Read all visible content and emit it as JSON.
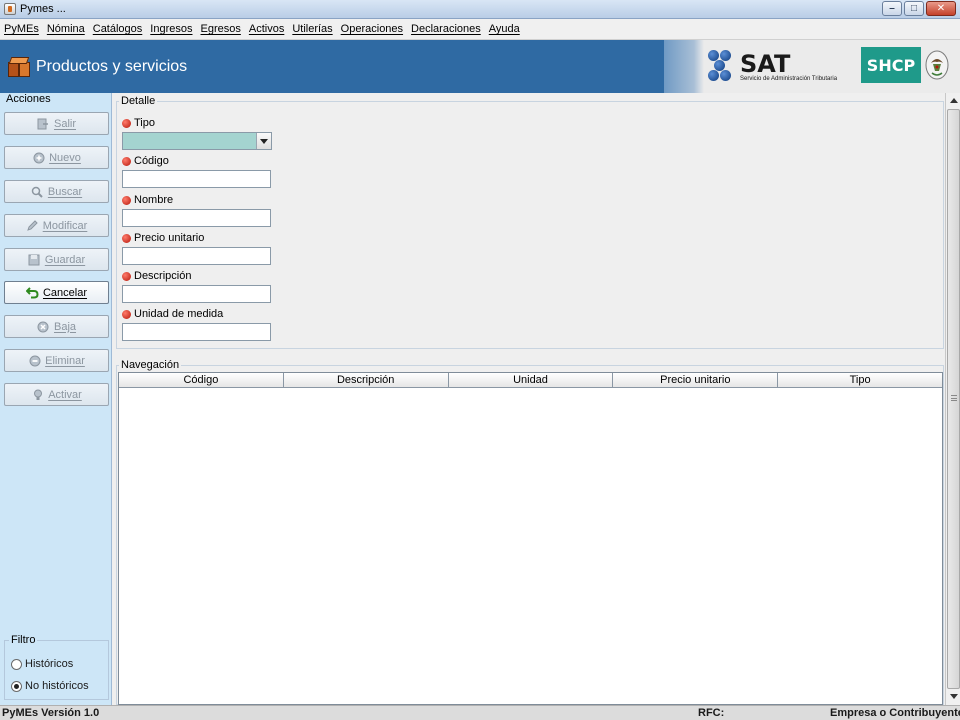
{
  "window": {
    "title": "Pymes ...",
    "controls": {
      "minimize": "–",
      "maximize": "□",
      "close": "✕"
    }
  },
  "menu": [
    "PyMEs",
    "Nómina",
    "Catálogos",
    "Ingresos",
    "Egresos",
    "Activos",
    "Utilerías",
    "Operaciones",
    "Declaraciones",
    "Ayuda"
  ],
  "header": {
    "title": "Productos y servicios",
    "icon": "box-icon",
    "sat_logo_text": "SAT",
    "sat_subtitle": "Servicio de Administración Tributaria",
    "shcp_label": "SHCP",
    "colors": {
      "banner": "#2f6aa3",
      "shcp": "#1f9a8a"
    }
  },
  "actions": {
    "title": "Acciones",
    "buttons": [
      {
        "label": "Salir",
        "icon": "exit-icon",
        "enabled": false
      },
      {
        "label": "Nuevo",
        "icon": "new-icon",
        "enabled": false
      },
      {
        "label": "Buscar",
        "icon": "search-icon",
        "enabled": false
      },
      {
        "label": "Modificar",
        "icon": "pencil-icon",
        "enabled": false
      },
      {
        "label": "Guardar",
        "icon": "save-icon",
        "enabled": false
      },
      {
        "label": "Cancelar",
        "icon": "undo-arrow-icon",
        "enabled": true
      },
      {
        "label": "Baja",
        "icon": "remove-icon",
        "enabled": false
      },
      {
        "label": "Eliminar",
        "icon": "delete-icon",
        "enabled": false
      },
      {
        "label": "Activar",
        "icon": "lightbulb-icon",
        "enabled": false
      }
    ]
  },
  "filter": {
    "title": "Filtro",
    "options": [
      {
        "label": "Históricos",
        "checked": false
      },
      {
        "label": "No históricos",
        "checked": true
      }
    ]
  },
  "detail": {
    "title": "Detalle",
    "fields": [
      {
        "label": "Tipo",
        "type": "select",
        "value": ""
      },
      {
        "label": "Código",
        "type": "text",
        "value": ""
      },
      {
        "label": "Nombre",
        "type": "text",
        "value": ""
      },
      {
        "label": "Precio unitario",
        "type": "text",
        "value": ""
      },
      {
        "label": "Descripción",
        "type": "text",
        "value": ""
      },
      {
        "label": "Unidad de medida",
        "type": "text",
        "value": ""
      }
    ]
  },
  "navigation": {
    "title": "Navegación",
    "columns": [
      "Código",
      "Descripción",
      "Unidad",
      "Precio unitario",
      "Tipo"
    ],
    "rows": []
  },
  "status": {
    "version": "PyMEs Versión 1.0",
    "rfc": "RFC:",
    "empresa": "Empresa o Contribuyente:"
  }
}
